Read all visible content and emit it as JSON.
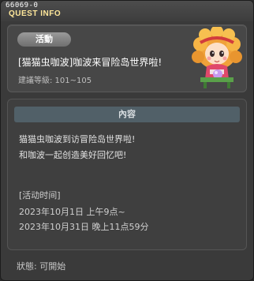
{
  "window": {
    "quest_id": "66069-0",
    "title": "QUEST INFO"
  },
  "quest": {
    "badge": "活動",
    "title": "[猫猫虫咖波]咖波来冒险岛世界啦!",
    "level": "建議等級: 101~105",
    "portrait_icon": "npc-girl-portrait"
  },
  "content": {
    "header": "內容",
    "lines": [
      "猫猫虫咖波到访冒险岛世界啦!",
      "和咖波一起创造美好回忆吧!"
    ],
    "time_label": "[活动时间]",
    "time_start": "2023年10月1日 上午9点~",
    "time_end": "2023年10月31日 晚上11点59分"
  },
  "status": "狀態: 可開始",
  "colors": {
    "title_text": "#ffe79a",
    "header_bar": "#516068",
    "panel_bg": "#474747",
    "window_bg": "#3a3a3a"
  }
}
